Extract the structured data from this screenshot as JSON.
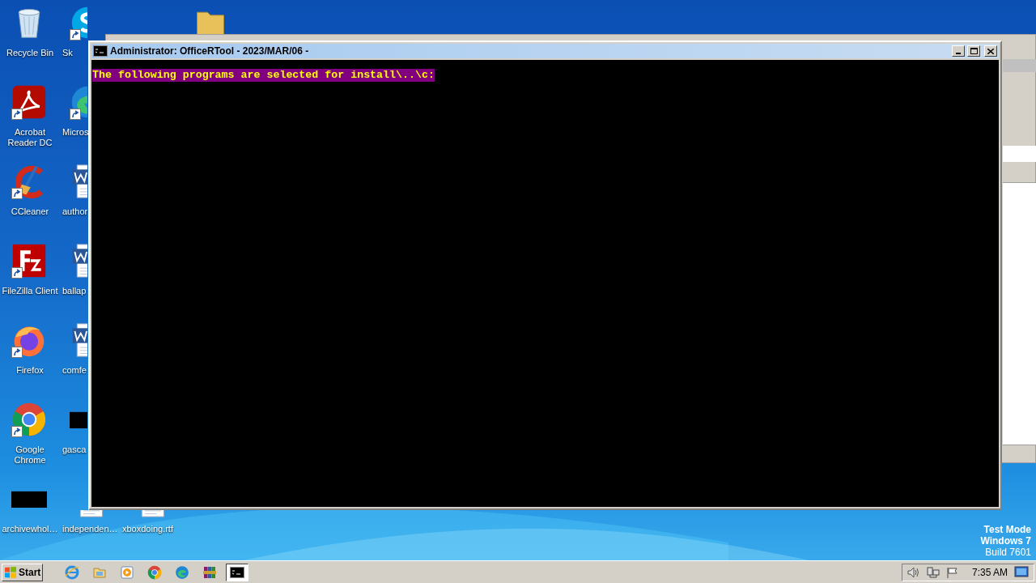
{
  "desktop": {
    "columns": [
      {
        "icons": [
          {
            "label": "Recycle Bin",
            "kind": "recycle",
            "shortcut": false
          },
          {
            "label": "Acrobat Reader DC",
            "kind": "pdf",
            "shortcut": true
          },
          {
            "label": "CCleaner",
            "kind": "ccleaner",
            "shortcut": true
          },
          {
            "label": "FileZilla Client",
            "kind": "filezilla",
            "shortcut": true
          },
          {
            "label": "Firefox",
            "kind": "firefox",
            "shortcut": true
          },
          {
            "label": "Google Chrome",
            "kind": "chrome",
            "shortcut": true
          },
          {
            "label": "archivewhol…",
            "kind": "blank",
            "shortcut": false
          }
        ]
      },
      {
        "icons": [
          {
            "label": "Sk",
            "kind": "skype",
            "shortcut": true
          },
          {
            "label": "Micros",
            "kind": "edge",
            "shortcut": true
          },
          {
            "label": "author",
            "kind": "word",
            "shortcut": false
          },
          {
            "label": "ballap",
            "kind": "word",
            "shortcut": false
          },
          {
            "label": "comfe",
            "kind": "word",
            "shortcut": false
          },
          {
            "label": "gasca",
            "kind": "blank",
            "shortcut": false
          },
          {
            "label": "independen…",
            "kind": "word"
          }
        ]
      },
      {
        "icons": [
          {
            "kind": "folder"
          },
          {
            "label": "xboxdoing.rtf",
            "kind": "word"
          }
        ]
      }
    ]
  },
  "console": {
    "title": "Administrator: OfficeRTool - 2023/MAR/06 -",
    "lines": [
      {
        "text": "The following programs are selected for install\\..\\c:",
        "highlighted": true
      }
    ]
  },
  "watermark": [
    "Test Mode",
    "Windows 7",
    "Build 7601"
  ],
  "taskbar": {
    "start": "Start",
    "items": [
      {
        "kind": "ie",
        "active": false
      },
      {
        "kind": "explorer",
        "active": false
      },
      {
        "kind": "media",
        "active": false
      },
      {
        "kind": "chrome",
        "active": false
      },
      {
        "kind": "edge",
        "active": false
      },
      {
        "kind": "winrar",
        "active": false
      },
      {
        "kind": "cmd",
        "active": true
      }
    ],
    "tray": {
      "icons": [
        {
          "kind": "speaker"
        },
        {
          "kind": "network"
        },
        {
          "kind": "flag"
        }
      ],
      "time": "7:35 AM"
    }
  }
}
